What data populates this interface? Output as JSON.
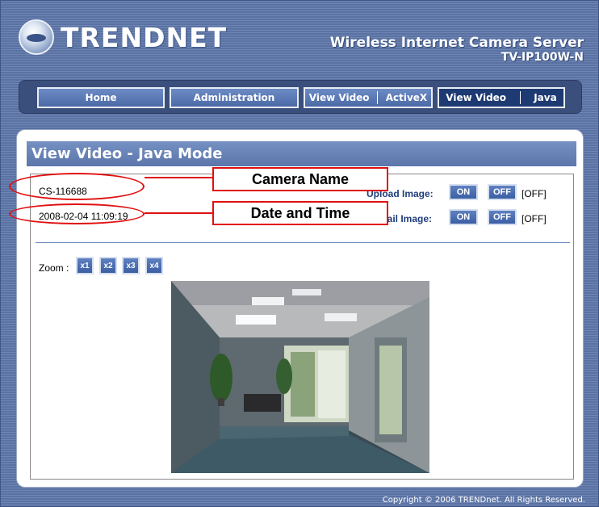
{
  "header": {
    "brand": "TRENDNET",
    "product_title": "Wireless Internet Camera Server",
    "model": "TV-IP100W-N"
  },
  "nav": {
    "home": "Home",
    "administration": "Administration",
    "view_video_activex": [
      "View Video",
      "ActiveX"
    ],
    "view_video_java": [
      "View Video",
      "Java"
    ],
    "active": "View Video | Java"
  },
  "panel": {
    "title": "View Video - Java Mode",
    "camera_name": "CS-116688",
    "datetime": "2008-02-04 11:09:19",
    "upload_image": {
      "label": "Upload Image:",
      "on": "ON",
      "off": "OFF",
      "status": "[OFF]"
    },
    "email_image": {
      "label": "Email Image:",
      "on": "ON",
      "off": "OFF",
      "status": "[OFF]"
    },
    "zoom": {
      "label": "Zoom :",
      "levels": [
        "x1",
        "x2",
        "x3",
        "x4"
      ]
    }
  },
  "annotations": {
    "camera_name": "Camera Name",
    "date_time": "Date and Time",
    "color": "#e01010"
  },
  "footer": {
    "copyright": "Copyright © 2006 TRENDnet. All Rights Reserved."
  },
  "colors": {
    "nav_bg": "#3a4f7c",
    "button_blue": "#3c5fa4",
    "title_bar": "#5c76ab"
  }
}
